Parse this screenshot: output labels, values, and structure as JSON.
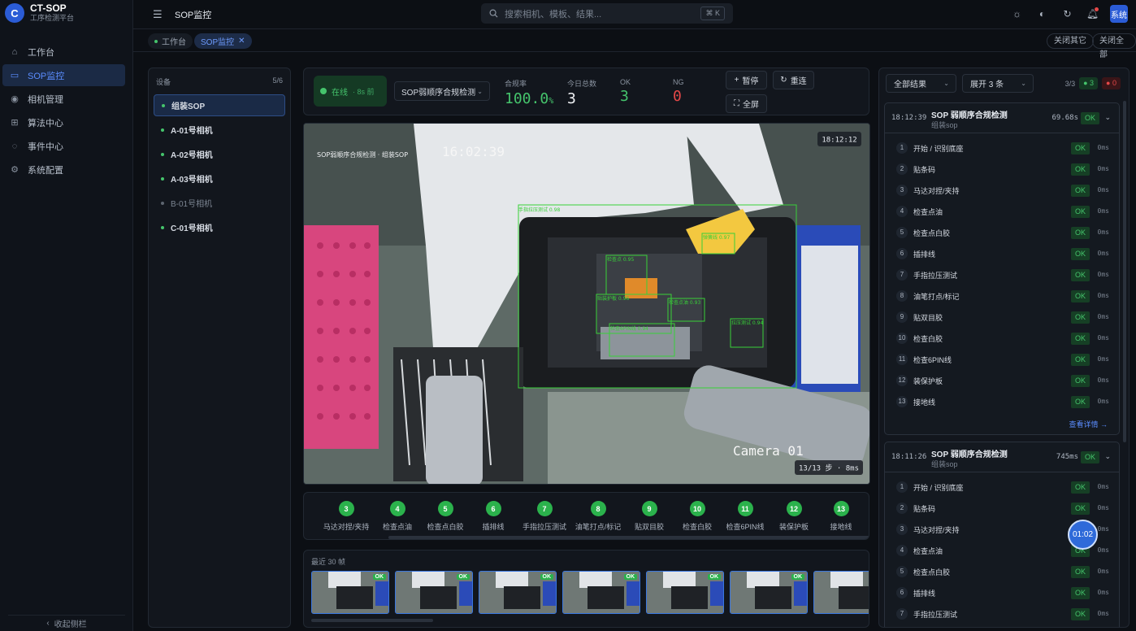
{
  "app": {
    "name": "CT-SOP",
    "subtitle": "工序检测平台"
  },
  "nav": [
    {
      "label": "工作台",
      "icon": "home-icon",
      "glyph": "⌂"
    },
    {
      "label": "SOP监控",
      "icon": "monitor-icon",
      "glyph": "▭"
    },
    {
      "label": "相机管理",
      "icon": "camera-icon",
      "glyph": "◉"
    },
    {
      "label": "算法中心",
      "icon": "grid-icon",
      "glyph": "⊞"
    },
    {
      "label": "事件中心",
      "icon": "message-icon",
      "glyph": "◌"
    },
    {
      "label": "系统配置",
      "icon": "gear-icon",
      "glyph": "⚙"
    }
  ],
  "sidebar_collapse": "收起侧栏",
  "header": {
    "title": "SOP监控",
    "search_placeholder": "搜索相机、模板、结果...",
    "search_shortcut": "⌘ K",
    "avatar": "系统"
  },
  "tabs": {
    "workbench": "工作台",
    "sop": "SOP监控",
    "close_others": "关闭其它",
    "close_all": "关闭全部"
  },
  "devices": {
    "header": "设备",
    "count": "5/6",
    "items": [
      {
        "name": "组装SOP",
        "online": true
      },
      {
        "name": "A-01号相机",
        "online": true
      },
      {
        "name": "A-02号相机",
        "online": true
      },
      {
        "name": "A-03号相机",
        "online": true
      },
      {
        "name": "B-01号相机",
        "online": false
      },
      {
        "name": "C-01号相机",
        "online": true
      }
    ]
  },
  "topbar": {
    "status": "在线",
    "status_time": "· 8s 前",
    "template": "SOP弱顺序合规检测",
    "pass_rate_label": "合规率",
    "pass_rate": "100.0",
    "pass_rate_unit": "%",
    "total_label": "今日总数",
    "total": "3",
    "ok_label": "OK",
    "ok": "3",
    "ng_label": "NG",
    "ng": "0",
    "pause": "暂停",
    "reconnect": "重连",
    "fullscreen": "全屏"
  },
  "video": {
    "overlay_title": "SOP弱顺序合规检测 · 组装SOP",
    "osd_time": "16:02:39",
    "timestamp": "18:12:12",
    "camera_label": "Camera 01",
    "progress": "13/13 步 · 8ms",
    "detections": [
      "弹簧线 0.97",
      "检查点 0.95",
      "贴装护板 0.96",
      "检查点油 0.93",
      "拉压测试 0.94",
      "检查6PIN线 0.94",
      "手指拉压测试 0.98"
    ]
  },
  "steps": [
    {
      "n": "3",
      "label": "马达对捏/夹持"
    },
    {
      "n": "4",
      "label": "检查点油"
    },
    {
      "n": "5",
      "label": "检查点白胶"
    },
    {
      "n": "6",
      "label": "插排线"
    },
    {
      "n": "7",
      "label": "手指拉压测试"
    },
    {
      "n": "8",
      "label": "油笔打点/标记"
    },
    {
      "n": "9",
      "label": "贴双目胶"
    },
    {
      "n": "10",
      "label": "检查白胶"
    },
    {
      "n": "11",
      "label": "检查6PIN线"
    },
    {
      "n": "12",
      "label": "装保护板"
    },
    {
      "n": "13",
      "label": "接地线"
    }
  ],
  "frames": {
    "header": "最近 30 帧",
    "badge": "OK"
  },
  "results": {
    "filter": "全部结果",
    "expand": "展开 3 条",
    "count": "3/3",
    "ok_count": "3",
    "ng_count": "0",
    "view_detail": "查看详情 →",
    "cards": [
      {
        "time": "18:12:39",
        "name": "SOP 弱顺序合规检测",
        "sub": "组装sop",
        "duration": "69.68s",
        "status": "OK",
        "rows": [
          {
            "n": "1",
            "label": "开始 / 识别底座",
            "status": "OK",
            "ms": "0ms"
          },
          {
            "n": "2",
            "label": "贴条码",
            "status": "OK",
            "ms": "0ms"
          },
          {
            "n": "3",
            "label": "马达对捏/夹持",
            "status": "OK",
            "ms": "0ms"
          },
          {
            "n": "4",
            "label": "检查点油",
            "status": "OK",
            "ms": "0ms"
          },
          {
            "n": "5",
            "label": "检查点白胶",
            "status": "OK",
            "ms": "0ms"
          },
          {
            "n": "6",
            "label": "插排线",
            "status": "OK",
            "ms": "0ms"
          },
          {
            "n": "7",
            "label": "手指拉压测试",
            "status": "OK",
            "ms": "0ms"
          },
          {
            "n": "8",
            "label": "油笔打点/标记",
            "status": "OK",
            "ms": "0ms"
          },
          {
            "n": "9",
            "label": "贴双目胶",
            "status": "OK",
            "ms": "0ms"
          },
          {
            "n": "10",
            "label": "检查白胶",
            "status": "OK",
            "ms": "0ms"
          },
          {
            "n": "11",
            "label": "检查6PIN线",
            "status": "OK",
            "ms": "0ms"
          },
          {
            "n": "12",
            "label": "装保护板",
            "status": "OK",
            "ms": "0ms"
          },
          {
            "n": "13",
            "label": "接地线",
            "status": "OK",
            "ms": "0ms"
          }
        ]
      },
      {
        "time": "18:11:26",
        "name": "SOP 弱顺序合规检测",
        "sub": "组装sop",
        "duration": "745ms",
        "status": "OK",
        "rows": [
          {
            "n": "1",
            "label": "开始 / 识别底座",
            "status": "OK",
            "ms": "0ms"
          },
          {
            "n": "2",
            "label": "贴条码",
            "status": "OK",
            "ms": "0ms"
          },
          {
            "n": "3",
            "label": "马达对捏/夹持",
            "status": "OK",
            "ms": "0ms"
          },
          {
            "n": "4",
            "label": "检查点油",
            "status": "OK",
            "ms": "0ms"
          },
          {
            "n": "5",
            "label": "检查点白胶",
            "status": "OK",
            "ms": "0ms"
          },
          {
            "n": "6",
            "label": "插排线",
            "status": "OK",
            "ms": "0ms"
          },
          {
            "n": "7",
            "label": "手指拉压测试",
            "status": "OK",
            "ms": "0ms"
          }
        ]
      }
    ]
  },
  "floating_timer": "01:02",
  "colors": {
    "accent": "#2b5cd6",
    "ok": "#2bb24c",
    "ng": "#e54848",
    "detect_box": "#38d038"
  }
}
